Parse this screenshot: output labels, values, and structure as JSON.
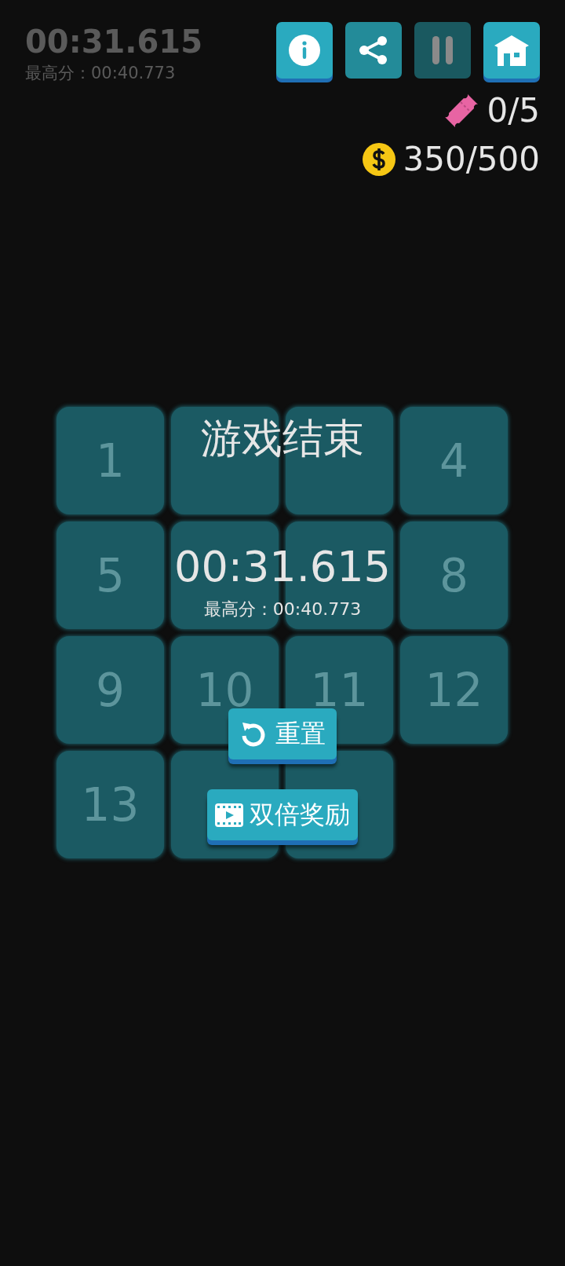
{
  "background_timer": {
    "time": "00:31.615",
    "best": "最高分：00:40.773"
  },
  "toolbar": [
    {
      "kind": "info",
      "disabled": false
    },
    {
      "kind": "share",
      "disabled": false
    },
    {
      "kind": "pause",
      "disabled": true
    },
    {
      "kind": "home",
      "disabled": false
    }
  ],
  "tickets": "0/5",
  "coins": "350/500",
  "tiles": [
    {
      "kind": "number",
      "label": "1"
    },
    {
      "kind": "covered"
    },
    {
      "kind": "covered"
    },
    {
      "kind": "number",
      "label": "4"
    },
    {
      "kind": "number",
      "label": "5"
    },
    {
      "kind": "covered"
    },
    {
      "kind": "covered"
    },
    {
      "kind": "number",
      "label": "8"
    },
    {
      "kind": "number",
      "label": "9"
    },
    {
      "kind": "number",
      "label": "10"
    },
    {
      "kind": "number",
      "label": "11"
    },
    {
      "kind": "number",
      "label": "12"
    },
    {
      "kind": "number",
      "label": "13"
    },
    {
      "kind": "covered"
    },
    {
      "kind": "covered"
    }
  ],
  "result": {
    "title": "游戏结束",
    "time": "00:31.615",
    "best": "最高分：00:40.773",
    "buttons": [
      {
        "kind": "reset",
        "label": "重置"
      },
      {
        "kind": "double_reward",
        "label": "双倍奖励"
      }
    ]
  }
}
